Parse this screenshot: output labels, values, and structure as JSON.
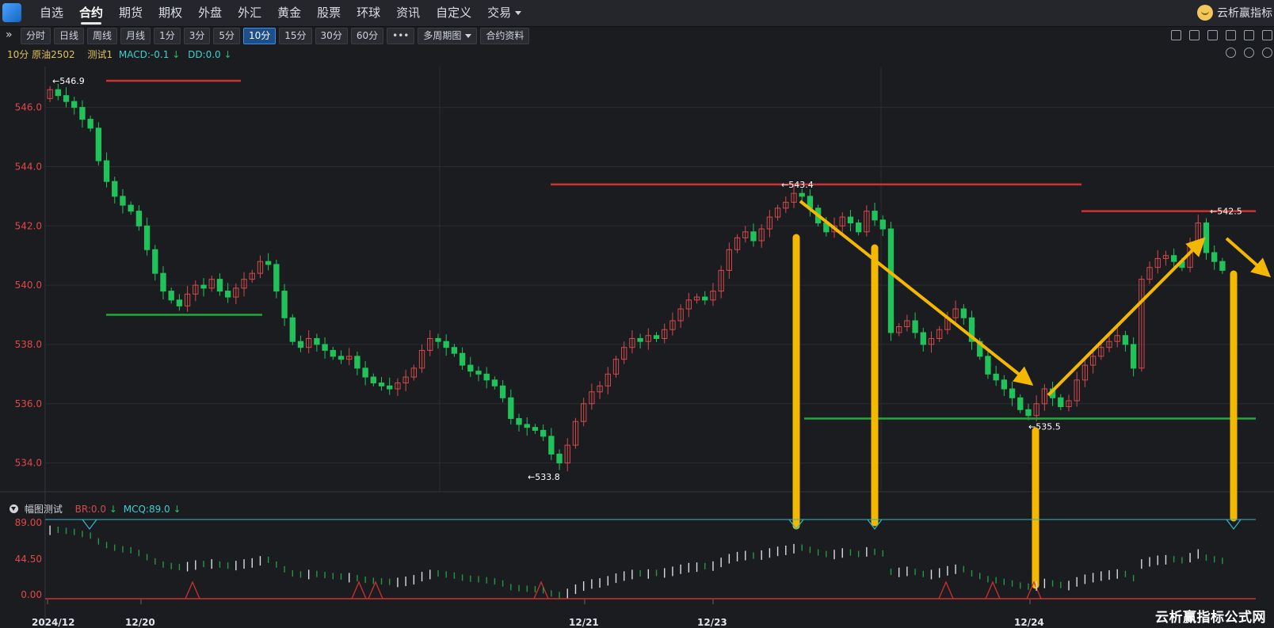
{
  "nav": {
    "items": [
      {
        "label": "自选",
        "active": false
      },
      {
        "label": "合约",
        "active": true
      },
      {
        "label": "期货",
        "active": false
      },
      {
        "label": "期权",
        "active": false
      },
      {
        "label": "外盘",
        "active": false
      },
      {
        "label": "外汇",
        "active": false
      },
      {
        "label": "黄金",
        "active": false
      },
      {
        "label": "股票",
        "active": false
      },
      {
        "label": "环球",
        "active": false
      },
      {
        "label": "资讯",
        "active": false
      },
      {
        "label": "自定义",
        "active": false
      },
      {
        "label": "交易",
        "active": false
      }
    ],
    "brand": "云析赢指标"
  },
  "toolbar": {
    "collapse_glyph": "»",
    "periods": [
      {
        "label": "分时"
      },
      {
        "label": "日线"
      },
      {
        "label": "周线"
      },
      {
        "label": "月线"
      },
      {
        "label": "1分"
      },
      {
        "label": "3分"
      },
      {
        "label": "5分"
      },
      {
        "label": "10分",
        "active": true
      },
      {
        "label": "15分"
      },
      {
        "label": "30分"
      },
      {
        "label": "60分"
      }
    ],
    "more": "•••",
    "multi_period": "多周期图",
    "contract_info": "合约资料",
    "icons": [
      "pen-icon",
      "bell-icon",
      "cloud-icon",
      "camera-icon",
      "copy-icon",
      "window-icon"
    ]
  },
  "info": {
    "period_symbol": "10分 原油2502",
    "indicator": "测试1",
    "macd": "MACD:-0.1",
    "dd": "DD:0.0",
    "arrow_down": "↓"
  },
  "sub_indicator": {
    "title": "幅图测试",
    "br": "BR:0.0",
    "mcq": "MCQ:89.0",
    "arrow_down": "↓"
  },
  "watermark": "云析赢指标公式网",
  "colors": {
    "up": "#d24a4a",
    "down": "#20c35a",
    "annotation": "#f5b800",
    "support": "#1faa3a",
    "resistance": "#d03030",
    "mcq_line": "#2fb8c8"
  },
  "chart_data": {
    "type": "candlestick",
    "y_ticks": [
      546.0,
      544.0,
      542.0,
      540.0,
      538.0,
      536.0,
      534.0
    ],
    "ylim": [
      533.0,
      547.3
    ],
    "sub_y_ticks": [
      "89.00",
      "44.50",
      "0.00"
    ],
    "x_labels": [
      "2024/12",
      "12/20",
      "12/21",
      "12/23",
      "12/24"
    ],
    "price_labels": {
      "high1": "546.9",
      "high2": "543.4",
      "high3": "542.5",
      "low1": "533.8",
      "low2": "535.5"
    },
    "resistance_levels": [
      546.9,
      543.4,
      542.5
    ],
    "support_levels": [
      539.0,
      535.5
    ],
    "closes": [
      546.6,
      546.4,
      546.2,
      546.0,
      545.6,
      545.3,
      544.2,
      543.5,
      543.0,
      542.7,
      542.5,
      542.0,
      541.2,
      540.4,
      539.8,
      539.5,
      539.3,
      539.7,
      540.0,
      539.9,
      540.2,
      539.8,
      539.6,
      539.9,
      540.2,
      540.4,
      540.8,
      540.7,
      539.8,
      538.9,
      538.1,
      537.9,
      538.2,
      538.0,
      537.8,
      537.6,
      537.5,
      537.6,
      537.2,
      536.9,
      536.7,
      536.6,
      536.5,
      536.7,
      536.9,
      537.2,
      537.8,
      538.2,
      538.1,
      537.9,
      537.7,
      537.3,
      537.1,
      537.0,
      536.8,
      536.6,
      536.2,
      535.5,
      535.3,
      535.2,
      535.1,
      534.9,
      534.3,
      534.0,
      534.6,
      535.4,
      536.0,
      536.4,
      536.6,
      537.0,
      537.5,
      537.9,
      538.2,
      538.1,
      538.3,
      538.2,
      538.5,
      538.8,
      539.2,
      539.5,
      539.6,
      539.5,
      539.8,
      540.5,
      541.2,
      541.6,
      541.8,
      541.5,
      541.9,
      542.3,
      542.6,
      542.8,
      543.1,
      543.0,
      542.6,
      542.1,
      541.8,
      542.0,
      542.3,
      542.1,
      541.8,
      542.5,
      542.2,
      541.9,
      538.4,
      538.6,
      538.8,
      538.4,
      538.0,
      538.2,
      538.5,
      538.9,
      539.2,
      538.9,
      538.1,
      537.6,
      537.0,
      536.8,
      536.5,
      536.2,
      535.8,
      535.6,
      536.0,
      536.5,
      536.2,
      535.9,
      536.1,
      536.8,
      537.3,
      537.6,
      537.9,
      538.1,
      538.3,
      538.0,
      537.2,
      540.2,
      540.6,
      540.9,
      541.0,
      540.8,
      540.6,
      541.4,
      542.1,
      541.1,
      540.8,
      540.5
    ]
  }
}
